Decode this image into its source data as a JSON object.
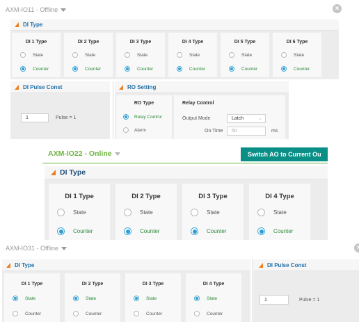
{
  "panel1": {
    "title": "AXM-IO11 - Offline",
    "di_type": {
      "heading": "DI Type",
      "cards": [
        {
          "title": "DI 1 Type",
          "selected": "Counter"
        },
        {
          "title": "DI 2 Type",
          "selected": "Counter"
        },
        {
          "title": "DI 3 Type",
          "selected": "Counter"
        },
        {
          "title": "DI 4 Type",
          "selected": "Counter"
        },
        {
          "title": "DI 5 Type",
          "selected": "Counter"
        },
        {
          "title": "DI 6 Type",
          "selected": "Counter"
        }
      ],
      "options": [
        "State",
        "Counter"
      ]
    },
    "pulse": {
      "heading": "DI Pulse Const",
      "value": "1",
      "suffix": "Pulse = 1"
    },
    "ro": {
      "heading": "RO Setting",
      "ro_type": {
        "title": "RO Type",
        "options": [
          "Relay Control",
          "Alarm"
        ],
        "selected": "Relay Control"
      },
      "relay": {
        "title": "Relay Control",
        "output_mode_label": "Output Mode",
        "output_mode_value": "Latch",
        "on_time_label": "On Time",
        "on_time_value": "50",
        "on_time_unit": "ms"
      }
    }
  },
  "panel2": {
    "title": "AXM-IO22 - Online",
    "button": "Switch AO to Current Ou",
    "di_type": {
      "heading": "DI Type",
      "cards": [
        {
          "title": "DI 1 Type",
          "selected": "Counter"
        },
        {
          "title": "DI 2 Type",
          "selected": "Counter"
        },
        {
          "title": "DI 3 Type",
          "selected": "Counter"
        },
        {
          "title": "DI 4 Type",
          "selected": "Counter"
        }
      ],
      "options": [
        "State",
        "Counter"
      ]
    }
  },
  "panel3": {
    "title": "AXM-IO31 - Offline",
    "di_type": {
      "heading": "DI Type",
      "cards": [
        {
          "title": "DI 1 Type",
          "selected": "State"
        },
        {
          "title": "DI 2 Type",
          "selected": "State"
        },
        {
          "title": "DI 3 Type",
          "selected": "State"
        },
        {
          "title": "DI 4 Type",
          "selected": "State"
        }
      ],
      "options": [
        "State",
        "Counter"
      ]
    },
    "pulse": {
      "heading": "DI Pulse Const",
      "value": "1",
      "suffix": "Pulse = 1"
    }
  },
  "icons": {
    "close": "close-icon",
    "dropdown": "caret-down-icon",
    "section": "orange-triangle-icon"
  },
  "colors": {
    "accent_blue": "#2f9bd0",
    "section_title": "#1f6fa8",
    "online_green": "#6cb33f",
    "button_teal": "#0a8f87",
    "triangle_orange": "#f07d1a"
  }
}
